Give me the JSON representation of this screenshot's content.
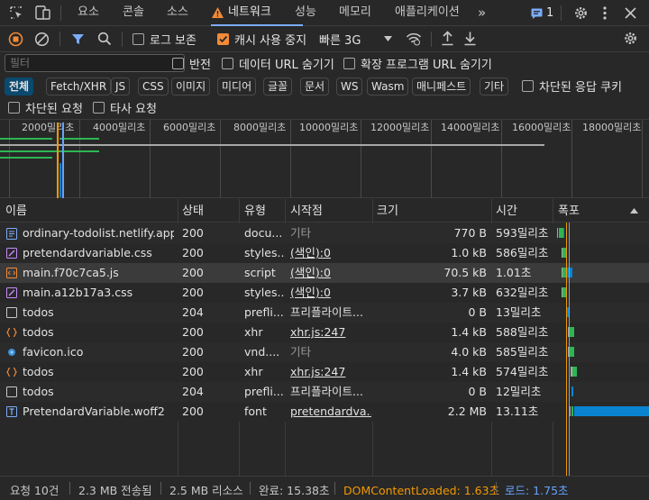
{
  "tabs": {
    "items": [
      "요소",
      "콘솔",
      "소스",
      "네트워크",
      "성능",
      "메모리",
      "애플리케이션"
    ],
    "more": "»",
    "issues_count": "1"
  },
  "toolbar": {
    "preserve_log": "로그 보존",
    "disable_cache": "캐시 사용 중지",
    "throttle": "빠른 3G"
  },
  "filter": {
    "placeholder": "필터",
    "invert": "반전",
    "hide_data_urls": "데이터 URL 숨기기",
    "hide_ext_urls": "확장 프로그램 URL 숨기기",
    "types": [
      "전체",
      "Fetch/XHR",
      "JS",
      "CSS",
      "이미지",
      "미디어",
      "글꼴",
      "문서",
      "WS",
      "Wasm",
      "매니페스트",
      "기타"
    ],
    "blocked_cookies": "차단된 응답 쿠키",
    "blocked_requests": "차단된 요청",
    "third_party": "타사 요청"
  },
  "overview": {
    "ticks": [
      "2000밀리초",
      "4000밀리초",
      "6000밀리초",
      "8000밀리초",
      "10000밀리초",
      "12000밀리초",
      "14000밀리초",
      "16000밀리초",
      "18000밀리초"
    ]
  },
  "columns": {
    "name": "이름",
    "status": "상태",
    "type": "유형",
    "initiator": "시작점",
    "size": "크기",
    "time": "시간",
    "waterfall": "폭포"
  },
  "rows": [
    {
      "icon": "document-icon",
      "name": "ordinary-todolist.netlify.app",
      "status": "200",
      "type": "docu...",
      "initiator": "기타",
      "initiator_style": "dim",
      "size": "770 B",
      "time": "593밀리초"
    },
    {
      "icon": "stylesheet-icon",
      "name": "pretendardvariable.css",
      "status": "200",
      "type": "styles...",
      "initiator": "(색인):0",
      "initiator_style": "link",
      "size": "1.0 kB",
      "time": "586밀리초"
    },
    {
      "icon": "script-icon",
      "name": "main.f70c7ca5.js",
      "status": "200",
      "type": "script",
      "initiator": "(색인):0",
      "initiator_style": "link",
      "size": "70.5 kB",
      "time": "1.01초"
    },
    {
      "icon": "stylesheet-icon",
      "name": "main.a12b17a3.css",
      "status": "200",
      "type": "styles...",
      "initiator": "(색인):0",
      "initiator_style": "link",
      "size": "3.7 kB",
      "time": "632밀리초"
    },
    {
      "icon": "blank-icon",
      "name": "todos",
      "status": "204",
      "type": "prefli...",
      "initiator": "프리플라이트...",
      "initiator_style": "plain",
      "size": "0 B",
      "time": "13밀리초"
    },
    {
      "icon": "xhr-icon",
      "name": "todos",
      "status": "200",
      "type": "xhr",
      "initiator": "xhr.js:247",
      "initiator_style": "link",
      "size": "1.4 kB",
      "time": "588밀리초"
    },
    {
      "icon": "favicon-icon",
      "name": "favicon.ico",
      "status": "200",
      "type": "vnd....",
      "initiator": "기타",
      "initiator_style": "dim",
      "size": "4.0 kB",
      "time": "585밀리초"
    },
    {
      "icon": "xhr-icon",
      "name": "todos",
      "status": "200",
      "type": "xhr",
      "initiator": "xhr.js:247",
      "initiator_style": "link",
      "size": "1.4 kB",
      "time": "574밀리초"
    },
    {
      "icon": "blank-icon",
      "name": "todos",
      "status": "204",
      "type": "prefli...",
      "initiator": "프리플라이트...",
      "initiator_style": "plain",
      "size": "0 B",
      "time": "12밀리초"
    },
    {
      "icon": "font-icon",
      "name": "PretendardVariable.woff2",
      "status": "200",
      "type": "font",
      "initiator": "pretendardva...",
      "initiator_style": "link",
      "size": "2.2 MB",
      "time": "13.11초"
    }
  ],
  "status_bar": {
    "requests": "요청 10건",
    "transferred": "2.3 MB 전송됨",
    "resources": "2.5 MB 리소스",
    "finish": "완료: 15.38초",
    "dcl": "DOMContentLoaded: 1.63초",
    "load": "로드: 1.75초"
  },
  "colors": {
    "accent": "#7cacf8",
    "orange": "#f28b38",
    "waterfall_blue": "#0a84d0",
    "waterfall_green": "#2db653",
    "dcl": "#f29900",
    "load": "#66a3ff"
  }
}
